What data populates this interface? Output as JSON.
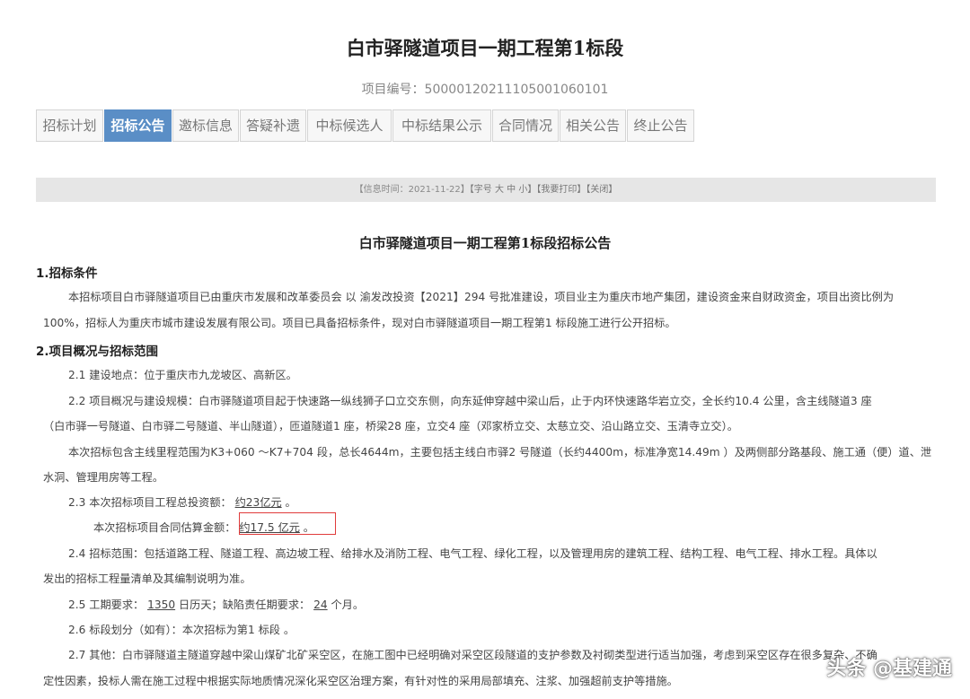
{
  "page": {
    "title": "白市驿隧道项目一期工程第1标段",
    "project_no": "项目编号：5000012021110500106010​1"
  },
  "tabs": [
    {
      "label": "招标计划",
      "active": false
    },
    {
      "label": "招标公告",
      "active": true
    },
    {
      "label": "邀标信息",
      "active": false
    },
    {
      "label": "答疑补遗",
      "active": false
    },
    {
      "label": "中标候选人",
      "active": false
    },
    {
      "label": "中标结果公示",
      "active": false
    },
    {
      "label": "合同情况",
      "active": false
    },
    {
      "label": "相关公告",
      "active": false
    },
    {
      "label": "终止公告",
      "active": false
    }
  ],
  "infobar": {
    "time": "【信息时间：2021-11-22】",
    "font": "【字号 大 中 小】",
    "print": "【我要打印】",
    "close": "【关闭】"
  },
  "notice": {
    "title": "白市驿隧道项目一期工程第1标段招标公告",
    "s1_head": "1.招标条件",
    "s1_p1": "本招标项目白市驿隧道项目已由重庆市发展和改革委员会 以 渝发改投资【2021】294 号批准建设，项目业主为重庆市地产集团，建设资金来自财政资金，项目出资比例为",
    "s1_p2": "100%，招标人为重庆市城市建设发展有限公司。项目已具备招标条件，现对白市驿隧道项目一期工程第1 标段施工进行公开招标。",
    "s2_head": "2.项目概况与招标范围",
    "s2_1": "2.1  建设地点：位于重庆市九龙坡区、高新区。",
    "s2_2a": "2.2  项目概况与建设规模：白市驿隧道项目起于快速路一纵线狮子口立交东侧，向东延伸穿越中梁山后，止于内环快速路华岩立交，全长约10.4 公里，含主线隧道3 座",
    "s2_2b": "（白市驿一号隧道、白市驿二号隧道、半山隧道），匝道隧道1 座，桥梁28 座，立交4 座（邓家桥立交、太慈立交、沿山路立交、玉清寺立交）。",
    "s2_2c": "本次招标包含主线里程范围为K3+060 ～K7+704 段，总长4644m，主要包括主线白市驿2 号隧道（长约4400m，标准净宽14.49m ）及两侧部分路基段、施工通（便）道、泄",
    "s2_2d": "水洞、管理用房等工程。",
    "s2_3a_label": "2.3  本次招标项目工程总投资额：",
    "s2_3a_value": "约23亿元",
    "s2_3b_label": "本次招标项目合同估算金额：",
    "s2_3b_value": "约17.5 亿元",
    "end_mark": "。",
    "s2_4a": "2.4  招标范围：包括道路工程、隧道工程、高边坡工程、给排水及消防工程、电气工程、绿化工程，以及管理用房的建筑工程、结构工程、电气工程、排水工程。具体以",
    "s2_4b": "发出的招标工程量清单及其编制说明为准。",
    "s2_5_label": "2.5  工期要求：",
    "s2_5_days": "1350",
    "s2_5_mid": "日历天；缺陷责任期要求：",
    "s2_5_months": "24",
    "s2_5_tail": "个月。",
    "s2_6": "2.6  标段划分（如有）：本次招标为第1 标段 。",
    "s2_7a": "2.7  其他：白市驿隧道主隧道穿越中梁山煤矿北矿采空区，在施工图中已经明确对采空区段隧道的支护参数及衬砌类型进行适当加强，考虑到采空区存在很多复杂、不确",
    "s2_7b": "定性因素，投标人需在施工过程中根据实际地质情况深化采空区治理方案，有针对性的采用局部填充、注浆、加强超前支护等措施。"
  },
  "watermark": "头条 @基建通"
}
